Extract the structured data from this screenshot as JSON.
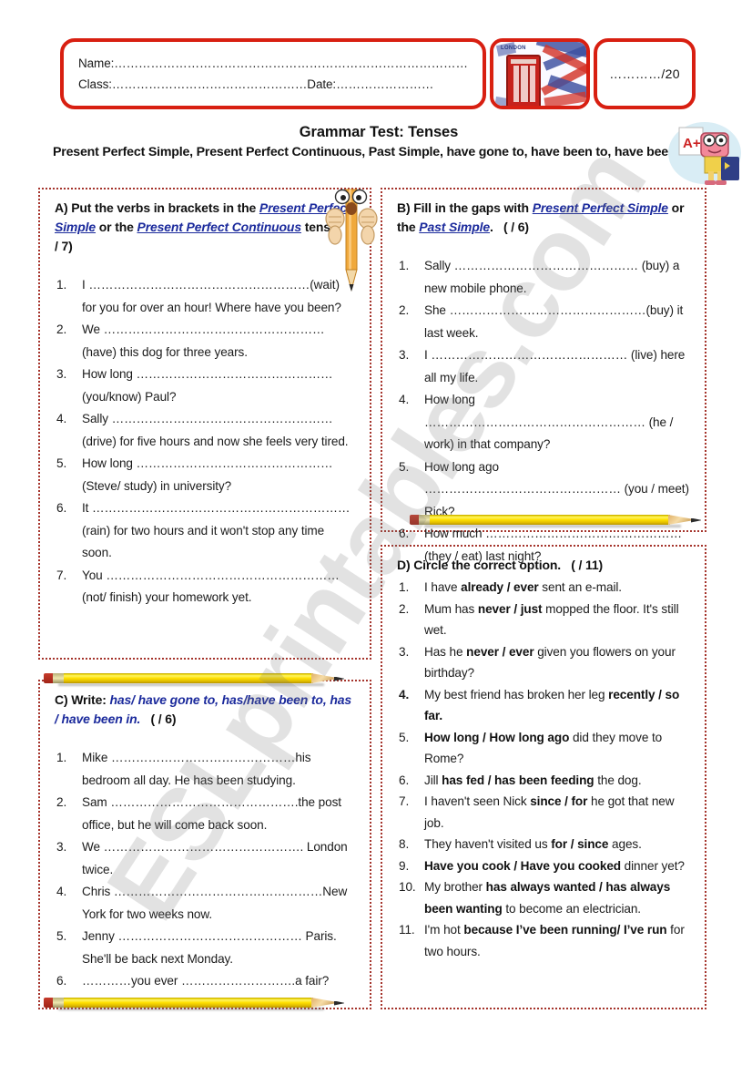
{
  "worksheet": {
    "header": {
      "name_line": "Name:……………………………………………………………………………",
      "class_line": "Class:…………………………………………Date:……………………",
      "score": "…………/20",
      "flag_label": "LONDON"
    },
    "title": "Grammar Test: Tenses",
    "subtitle": "Present Perfect Simple, Present Perfect Continuous, Past Simple, have gone to, have been to, have been in",
    "sections": [
      {
        "id": "A",
        "heading_parts": [
          {
            "text": "A) Put the verbs in brackets in the ",
            "style": "plain"
          },
          {
            "text": "Present Perfect Simple",
            "style": "term"
          },
          {
            "text": " or the ",
            "style": "plain"
          },
          {
            "text": "Present Perfect Continuous",
            "style": "term"
          },
          {
            "text": " tense.",
            "style": "plain"
          }
        ],
        "points": "(     / 7)",
        "questions": [
          "I ………………………………………………(wait) for you for over an hour! Where have you been?",
          "We ……………………………………………… (have) this dog for three years.",
          "How long ………………………………………… (you/know) Paul?",
          "Sally ……………………………………………… (drive) for five hours and now she feels very tired.",
          "How long ………………………………………… (Steve/ study) in university?",
          "It ……………………………………………………… (rain) for two hours and it won't stop any time soon.",
          "You ………………………………………………… (not/ finish) your homework yet."
        ]
      },
      {
        "id": "B",
        "heading_parts": [
          {
            "text": "B) Fill in the gaps with ",
            "style": "plain"
          },
          {
            "text": "Present Perfect Simple",
            "style": "term"
          },
          {
            "text": " or the ",
            "style": "plain"
          },
          {
            "text": "Past Simple",
            "style": "term"
          },
          {
            "text": ".",
            "style": "plain"
          }
        ],
        "points": "(     / 6)",
        "questions": [
          "Sally ……………………………………… (buy) a new mobile phone.",
          "She …………………………………………(buy) it last week.",
          "I ………………………………………… (live) here all my life.",
          "How long ……………………………………………… (he / work) in that company?",
          "How long ago ………………………………………… (you / meet) Rick?",
          "How much ………………………………………… (they / eat) last night?"
        ]
      },
      {
        "id": "C",
        "heading_parts": [
          {
            "text": "C) Write: ",
            "style": "plain"
          },
          {
            "text": "has/ have gone to, has/have been to, has / have been in.",
            "style": "term-plain"
          }
        ],
        "points": "(     / 6)",
        "questions": [
          "Mike ………………………………………his bedroom all day. He has been studying.",
          "Sam ……………………………………….the post office, but he will come back soon.",
          "We …………………………………………. London twice.",
          "Chris ……………………………………………New York for two weeks now.",
          "Jenny ……………………………………… Paris. She'll be back next Monday.",
          "…………you ever ……………………….a fair?"
        ]
      },
      {
        "id": "D",
        "heading_parts": [
          {
            "text": "D) Circle the correct option.",
            "style": "plain"
          }
        ],
        "points": "(      / 11)",
        "questions": [
          [
            {
              "t": "I have ",
              "b": false
            },
            {
              "t": "already / ever",
              "b": true
            },
            {
              "t": " sent an e-mail.",
              "b": false
            }
          ],
          [
            {
              "t": "Mum has ",
              "b": false
            },
            {
              "t": "never / just",
              "b": true
            },
            {
              "t": " mopped the floor. It's still wet.",
              "b": false
            }
          ],
          [
            {
              "t": "Has he ",
              "b": false
            },
            {
              "t": "never / ever",
              "b": true
            },
            {
              "t": " given you flowers on your birthday?",
              "b": false
            }
          ],
          [
            {
              "t": "My best friend has broken her leg ",
              "b": false
            },
            {
              "t": "recently / so far.",
              "b": true
            }
          ],
          [
            {
              "t": "How long / How long ago",
              "b": true
            },
            {
              "t": " did they move to Rome?",
              "b": false
            }
          ],
          [
            {
              "t": "Jill ",
              "b": false
            },
            {
              "t": "has fed / has been feeding",
              "b": true
            },
            {
              "t": " the dog.",
              "b": false
            }
          ],
          [
            {
              "t": "I haven't seen Nick ",
              "b": false
            },
            {
              "t": "since / for",
              "b": true
            },
            {
              "t": " he got that new job.",
              "b": false
            }
          ],
          [
            {
              "t": "They haven't visited us ",
              "b": false
            },
            {
              "t": "for / since",
              "b": true
            },
            {
              "t": " ages.",
              "b": false
            }
          ],
          [
            {
              "t": "Have you cook / Have you cooked",
              "b": true
            },
            {
              "t": " dinner yet?",
              "b": false
            }
          ],
          [
            {
              "t": "My brother ",
              "b": false
            },
            {
              "t": "has always wanted / has always been wanting",
              "b": true
            },
            {
              "t": " to become an electrician.",
              "b": false
            }
          ],
          [
            {
              "t": "I'm hot ",
              "b": false
            },
            {
              "t": "because I’ve been running/ I’ve run",
              "b": true
            },
            {
              "t": " for two hours.",
              "b": false
            }
          ]
        ]
      }
    ],
    "watermark": "ESLprintables.com",
    "colors": {
      "frame_red": "#d81f11",
      "box_dotted": "#a5342c",
      "term_blue": "#1b2a9c",
      "pencil_yellow": "#ffe000"
    }
  }
}
